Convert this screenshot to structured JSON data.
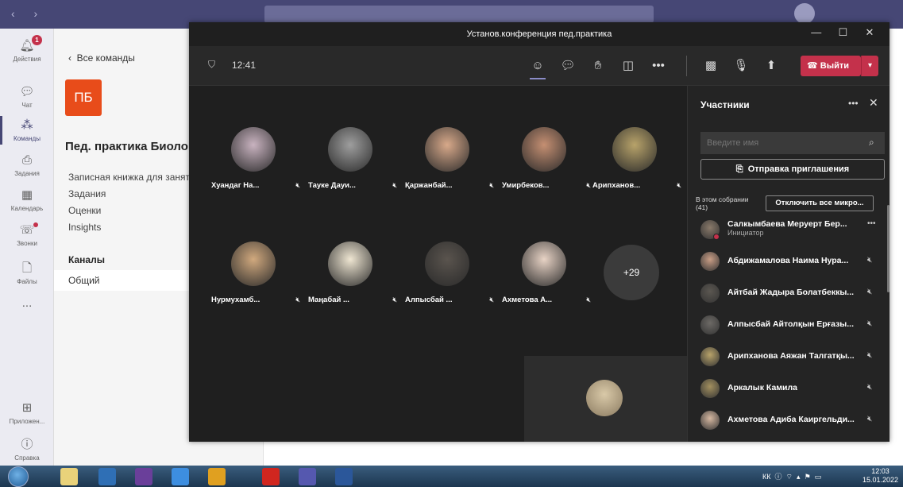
{
  "teams": {
    "rail": [
      {
        "label": "Действия",
        "icon": "bell-icon",
        "badge": "1"
      },
      {
        "label": "Чат",
        "icon": "chat-icon"
      },
      {
        "label": "Команды",
        "icon": "teams-icon"
      },
      {
        "label": "Задания",
        "icon": "assignments-icon"
      },
      {
        "label": "Календарь",
        "icon": "calendar-icon"
      },
      {
        "label": "Звонки",
        "icon": "phone-icon"
      },
      {
        "label": "Файлы",
        "icon": "files-icon"
      },
      {
        "label": "...",
        "icon": "more-icon"
      },
      {
        "label": "Приложен...",
        "icon": "apps-icon"
      },
      {
        "label": "Справка",
        "icon": "help-icon"
      }
    ],
    "back_label": "Все команды",
    "team_initials": "ПБ",
    "team_name": "Пед. практика Биоло",
    "links": [
      "Записная книжка для заняти",
      "Задания",
      "Оценки",
      "Insights"
    ],
    "channels_label": "Каналы",
    "channel_general": "Общий"
  },
  "meeting": {
    "title": "Установ.конференция пед.практика",
    "window_buttons": [
      "—",
      "☐",
      "✕"
    ],
    "time": "12:41",
    "leave_label": "Выйти",
    "participants_tiles": [
      {
        "name": "Хуандаг На...",
        "color": "#c9b3c0"
      },
      {
        "name": "Тауке Дауи...",
        "color": "#9e9e9e"
      },
      {
        "name": "Қаржанбай...",
        "color": "#d8a98a"
      },
      {
        "name": "Умирбеков...",
        "color": "#c58f72"
      },
      {
        "name": "Арипханов...",
        "color": "#b8a36a"
      },
      {
        "name": "Нурмухамб...",
        "color": "#d1a97e"
      },
      {
        "name": "Маңабай ...",
        "color": "#efe6d2"
      },
      {
        "name": "Алпысбай ...",
        "color": "#5a544e"
      },
      {
        "name": "Ахметова А...",
        "color": "#e8d3c5"
      }
    ],
    "more_count": "+29"
  },
  "participants_panel": {
    "title": "Участники",
    "search_placeholder": "Введите имя",
    "invite_label": "Отправка приглашения",
    "section_label": "В этом собрании",
    "section_count": "(41)",
    "mute_all_label": "Отключить все микро...",
    "people": [
      {
        "name": "Салкымбаева Меруерт Бер...",
        "role": "Инициатор",
        "color": "#8a7a6a"
      },
      {
        "name": "Абдижамалова Наима Нура...",
        "color": "#c99e86"
      },
      {
        "name": "Айтбай Жадыра Болатбеккы...",
        "color": "#5b5751"
      },
      {
        "name": "Алпысбай Айтолқын Ерғазы...",
        "color": "#6d6a66"
      },
      {
        "name": "Арипханова Аяжан Талгатқы...",
        "color": "#b8a36a"
      },
      {
        "name": "Аркалык Камила",
        "color": "#a3905f"
      },
      {
        "name": "Ахметова Адиба Каиргельди...",
        "color": "#d6b8a1"
      }
    ]
  },
  "taskbar": {
    "tray_lang": "КК",
    "clock_time": "12:03",
    "clock_date": "15.01.2022"
  }
}
